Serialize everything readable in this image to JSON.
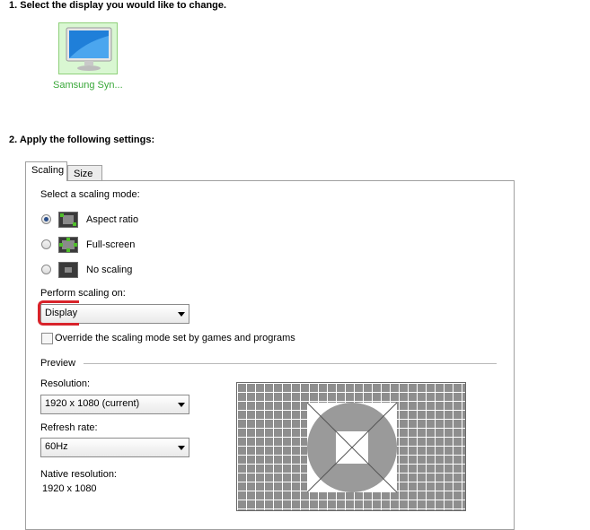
{
  "step1": {
    "heading": "1. Select the display you would like to change."
  },
  "display": {
    "label": "Samsung Syn..."
  },
  "step2": {
    "heading": "2. Apply the following settings:"
  },
  "tabs": [
    {
      "label": "Scaling"
    },
    {
      "label": "Size"
    }
  ],
  "scaling": {
    "mode_prompt": "Select a scaling mode:",
    "modes": [
      {
        "label": "Aspect ratio",
        "selected": true
      },
      {
        "label": "Full-screen",
        "selected": false
      },
      {
        "label": "No scaling",
        "selected": false
      }
    ],
    "perform_on_label": "Perform scaling on:",
    "perform_on_value": "Display",
    "override_label": "Override the scaling mode set by games and programs",
    "override_checked": false
  },
  "preview": {
    "section_label": "Preview",
    "resolution_label": "Resolution:",
    "resolution_value": "1920 x 1080 (current)",
    "refresh_label": "Refresh rate:",
    "refresh_value": "60Hz",
    "native_label": "Native resolution:",
    "native_value": "1920 x 1080"
  },
  "colors": {
    "accent_green": "#3aa83a",
    "highlight_red": "#d8232a"
  }
}
